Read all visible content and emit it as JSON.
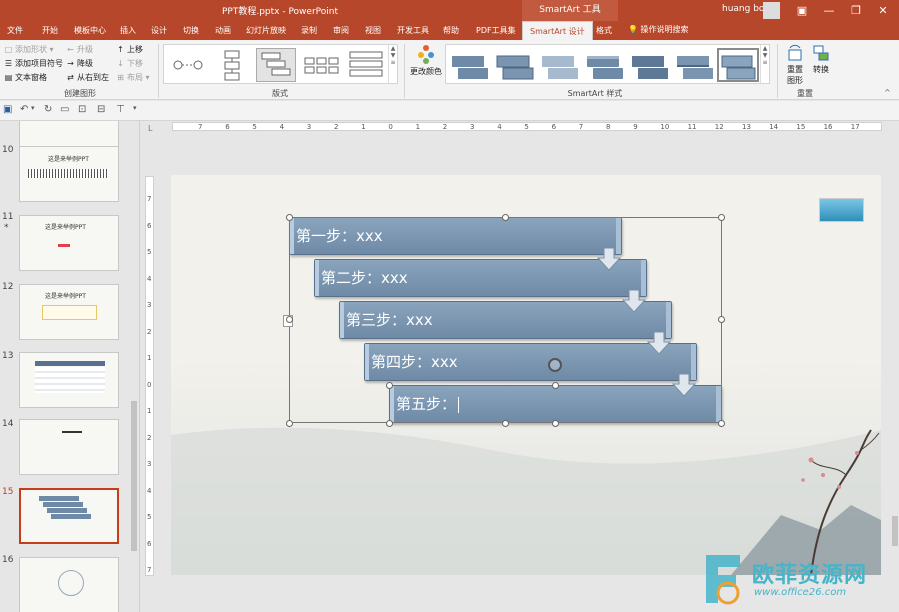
{
  "titlebar": {
    "title": "PPT教程.pptx  -  PowerPoint",
    "context_tools": "SmartArt 工具",
    "user": "huang bo"
  },
  "tabs": [
    "文件",
    "开始",
    "模板中心",
    "插入",
    "设计",
    "切换",
    "动画",
    "幻灯片放映",
    "录制",
    "审阅",
    "视图",
    "开发工具",
    "帮助",
    "PDF工具集",
    "SmartArt 设计",
    "格式"
  ],
  "tell_me": "操作说明搜索",
  "ribbon": {
    "create": {
      "add_shape": "添加形状",
      "add_bullet": "添加项目符号",
      "text_pane": "文本窗格",
      "promote": "升级",
      "demote": "降级",
      "rtl": "从右到左",
      "move_up": "上移",
      "move_down": "下移",
      "layout": "布局",
      "label": "创建图形"
    },
    "layouts": {
      "label": "版式"
    },
    "colors": {
      "label": "更改颜色"
    },
    "styles": {
      "label": "SmartArt 样式"
    },
    "reset": {
      "reset_graphic": "重置",
      "reset_graphic2": "图形",
      "convert": "转换",
      "label": "重置"
    }
  },
  "slides": [
    {
      "num": "10",
      "title": "这是来举例PPT"
    },
    {
      "num": "11",
      "title": "这是来举例PPT",
      "star": "*"
    },
    {
      "num": "12",
      "title": "这是来举例PPT"
    },
    {
      "num": "13"
    },
    {
      "num": "14"
    },
    {
      "num": "15"
    },
    {
      "num": "16"
    }
  ],
  "ruler": {
    "h": [
      "7",
      "6",
      "5",
      "4",
      "3",
      "2",
      "1",
      "0",
      "1",
      "2",
      "3",
      "4",
      "5",
      "6",
      "7",
      "8",
      "9",
      "10",
      "11",
      "12",
      "13",
      "14",
      "15",
      "16",
      "17"
    ],
    "v": [
      "7",
      "6",
      "5",
      "4",
      "3",
      "2",
      "1",
      "0",
      "1",
      "2",
      "3",
      "4",
      "5",
      "6",
      "7"
    ]
  },
  "steps": [
    {
      "text": "第一步：xxx"
    },
    {
      "text": "第二步：xxx"
    },
    {
      "text": "第三步：xxx"
    },
    {
      "text": "第四步：xxx"
    },
    {
      "text": "第五步："
    }
  ],
  "watermark": {
    "text": "欧菲资源网",
    "url": "www.office26.com"
  },
  "colors": {
    "accent": "#b7472a",
    "step_fill": "#7b95b0",
    "selected_thumb_border": "#c43e1c"
  }
}
